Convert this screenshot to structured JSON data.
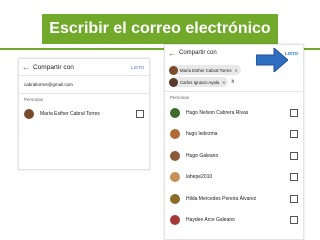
{
  "title": "Escribir el correo electrónico",
  "left_screen": {
    "header_title": "Compartir con",
    "done_label": "LISTO",
    "email_value": "cabraltorres@gmail.com",
    "section_label": "Personas",
    "people": [
      {
        "name": "María Esther Cabral Torres"
      }
    ]
  },
  "right_screen": {
    "header_title": "Compartir con",
    "done_label": "LISTO",
    "chips": [
      {
        "label": "María Esther Cabral Torres",
        "remove": "✕"
      },
      {
        "label": "Carlos Ignacio Ayala",
        "remove": "✕"
      }
    ],
    "typed_text": "h",
    "section_label": "Personas",
    "people": [
      {
        "name": "Hugo Nelson Cabrera Rivas"
      },
      {
        "name": "hugo ledezma"
      },
      {
        "name": "Hugo Galeano"
      },
      {
        "name": "lahepe2010"
      },
      {
        "name": "Hilda Mercedes Pereira Álvarez"
      },
      {
        "name": "Haydee Arce Galeano"
      }
    ]
  },
  "icons": {
    "back": "back-arrow-icon",
    "pointer": "blue-arrow-icon"
  },
  "colors": {
    "title_bg": "#71a92a",
    "arrow": "#2f6fc1",
    "done_blue": "#1a73e8"
  }
}
